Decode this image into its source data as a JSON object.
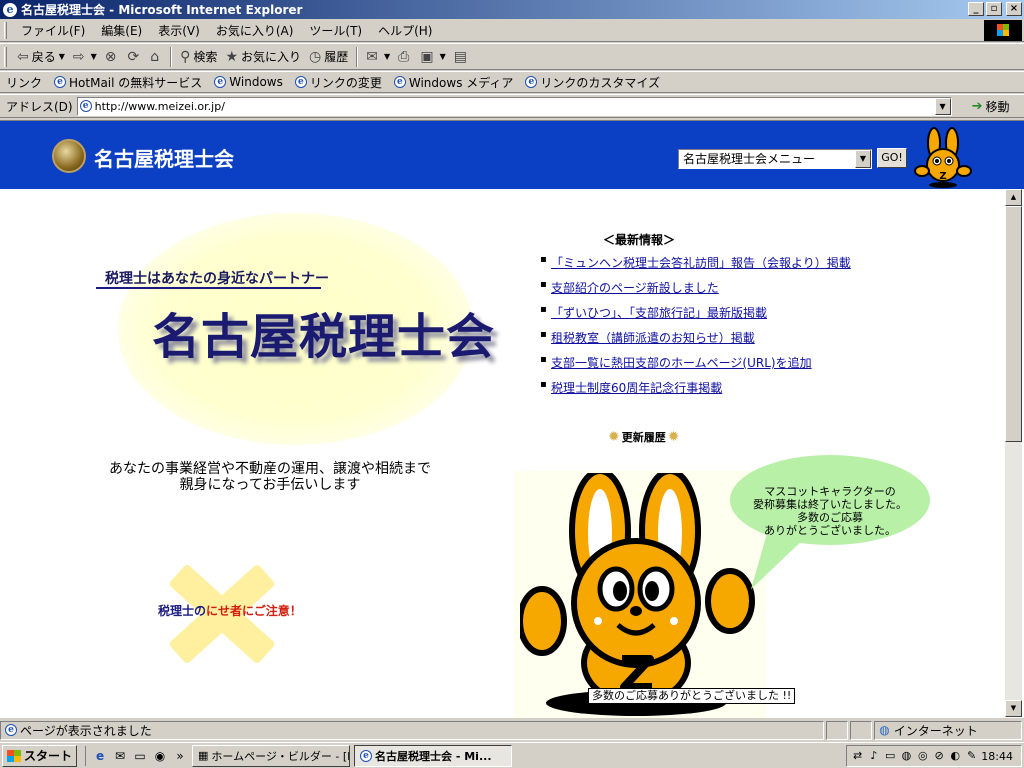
{
  "window": {
    "title": "名古屋税理士会 - Microsoft Internet Explorer"
  },
  "menu": [
    "ファイル(F)",
    "編集(E)",
    "表示(V)",
    "お気に入り(A)",
    "ツール(T)",
    "ヘルプ(H)"
  ],
  "toolbar": {
    "back": "戻る",
    "search": "検索",
    "favorites": "お気に入り",
    "history": "履歴"
  },
  "links": {
    "label": "リンク",
    "items": [
      "HotMail の無料サービス",
      "Windows",
      "リンクの変更",
      "Windows メディア",
      "リンクのカスタマイズ"
    ]
  },
  "address": {
    "label": "アドレス(D)",
    "url": "http://www.meizei.or.jp/",
    "go": "移動"
  },
  "site": {
    "name": "名古屋税理士会",
    "menu_select": "名古屋税理士会メニュー",
    "go_button": "GO!",
    "tagline": "税理士はあなたの身近なパートナー",
    "title": "名古屋税理士会",
    "subtext_1": "あなたの事業経営や不動産の運用、譲渡や相続まで",
    "subtext_2": "親身になってお手伝いします",
    "warning_a": "税理士の",
    "warning_b": "にせ者にご注意！",
    "news_heading": "＜最新情報＞",
    "news": [
      "「ミュンヘン税理士会答礼訪問」報告（会報より）掲載",
      "支部紹介のページ新設しました",
      "「ずいひつ」、「支部旅行記」最新版掲載",
      "租税教室（講師派遣のお知らせ）掲載",
      "支部一覧に熱田支部のホームページ(URL)を追加",
      "税理士制度60周年記念行事掲載"
    ],
    "history_label": "更新履歴",
    "bubble_lines": [
      "マスコットキャラクターの",
      "愛称募集は終了いたしました。",
      "多数のご応募",
      "ありがとうございました。"
    ],
    "caption": "多数のご応募ありがとうございました !!"
  },
  "status": {
    "text": "ページが表示されました",
    "zone": "インターネット"
  },
  "taskbar": {
    "start": "スタート",
    "tasks": [
      "ホームページ・ビルダー - [Ii...",
      "名古屋税理士会 - Mi..."
    ],
    "clock": "18:44"
  },
  "colors": {
    "header_blue": "#0b3fc4",
    "mascot_orange": "#f7a800",
    "bubble_green": "#b8f0a8"
  }
}
